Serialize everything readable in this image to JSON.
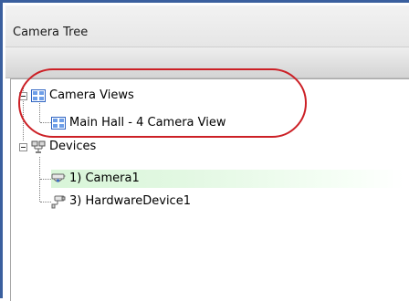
{
  "panel": {
    "title": "Camera Tree"
  },
  "tree": {
    "camera_views": {
      "label": "Camera Views",
      "icon": "grid-view-icon",
      "children": [
        {
          "label": "Main Hall - 4 Camera View",
          "icon": "grid-view-icon"
        }
      ]
    },
    "devices": {
      "label": "Devices",
      "icon": "network-devices-icon",
      "children": [
        {
          "label": "1) Camera1",
          "icon": "dome-camera-icon",
          "selected": true
        },
        {
          "label": "3) HardwareDevice1",
          "icon": "box-camera-icon",
          "selected": false
        }
      ]
    }
  },
  "colors": {
    "frame_border": "#3a5f9e",
    "highlight": "#cc2026",
    "selection": "#d8f5d8",
    "grid_icon": "#2f64c2"
  }
}
